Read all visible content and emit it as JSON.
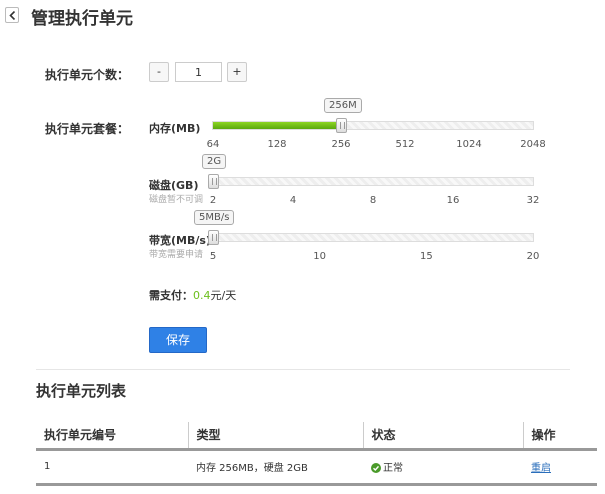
{
  "header": {
    "title": "管理执行单元"
  },
  "count": {
    "label": "执行单元个数：",
    "minus": "-",
    "plus": "+",
    "value": "1"
  },
  "plan": {
    "label": "执行单元套餐：",
    "memory": {
      "label": "内存(MB)",
      "value_label": "256M",
      "value": 256,
      "ticks": [
        "64",
        "128",
        "256",
        "512",
        "1024",
        "2048"
      ]
    },
    "disk": {
      "label": "磁盘(GB)",
      "note": "磁盘暂不可调",
      "value_label": "2G",
      "value": 2,
      "ticks": [
        "2",
        "4",
        "8",
        "16",
        "32"
      ]
    },
    "bandwidth": {
      "label": "带宽(MB/s)",
      "note": "带宽需要申请",
      "value_label": "5MB/s",
      "value": 5,
      "ticks": [
        "5",
        "10",
        "15",
        "20"
      ]
    }
  },
  "price": {
    "label": "需支付：",
    "amount": "0.4",
    "unit": "元/天"
  },
  "save_label": "保存",
  "list": {
    "title": "执行单元列表",
    "columns": [
      "执行单元编号",
      "类型",
      "状态",
      "操作"
    ],
    "rows": [
      {
        "id": "1",
        "type": "内存 256MB，硬盘 2GB",
        "status": "正常",
        "action": "重启"
      }
    ]
  },
  "colors": {
    "accent": "#2f81e6",
    "fill": "#6cbf1d",
    "link": "#2a6ebb",
    "ok": "#4a9a2a"
  }
}
